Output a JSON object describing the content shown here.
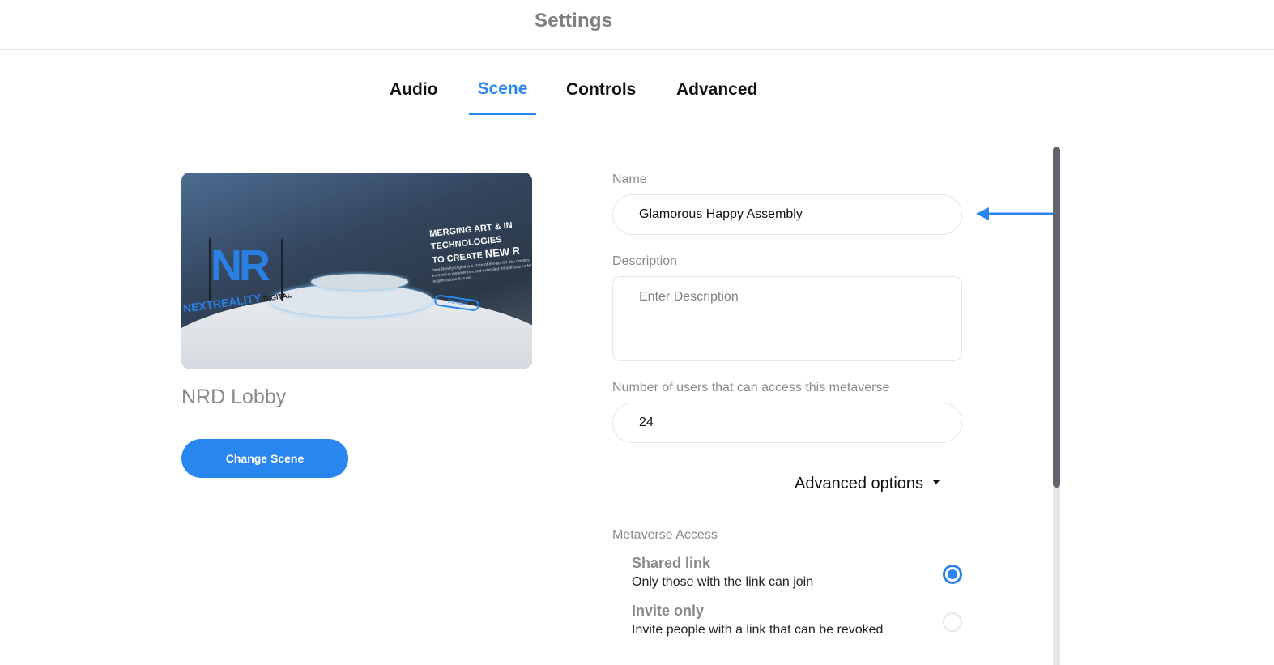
{
  "header": {
    "title": "Settings"
  },
  "tabs": [
    {
      "label": "Audio",
      "active": false
    },
    {
      "label": "Scene",
      "active": true
    },
    {
      "label": "Controls",
      "active": false
    },
    {
      "label": "Advanced",
      "active": false
    }
  ],
  "scene": {
    "preview": {
      "brand": "NEXTREALITY",
      "brand_suffix": ".DIGITAL",
      "logo": "NR",
      "headline_1": "MERGING ART & IN",
      "headline_2": "TECHNOLOGIES",
      "headline_3_prefix": "TO CREATE ",
      "headline_3_big": "NEW R",
      "body": "Next Reality Digital is a state-of-the-art XR dev creates immersive experiences and extended infrastructures for artists, organizations & busin",
      "contact": "Contact"
    },
    "name": "NRD Lobby",
    "change_button": "Change Scene"
  },
  "form": {
    "name_label": "Name",
    "name_value": "Glamorous Happy Assembly",
    "description_label": "Description",
    "description_placeholder": "Enter Description",
    "description_value": "",
    "users_label": "Number of users that can access this metaverse",
    "users_value": "24",
    "advanced_options": "Advanced options",
    "access_label": "Metaverse Access",
    "access_options": [
      {
        "title": "Shared link",
        "description": "Only those with the link can join",
        "selected": true
      },
      {
        "title": "Invite only",
        "description": "Invite people with a link that can be revoked",
        "selected": false
      }
    ]
  },
  "colors": {
    "accent": "#2a86ef",
    "muted_text": "#8a8a8a",
    "border": "#e6e6e6",
    "scrollbar_thumb": "#5f656c"
  }
}
